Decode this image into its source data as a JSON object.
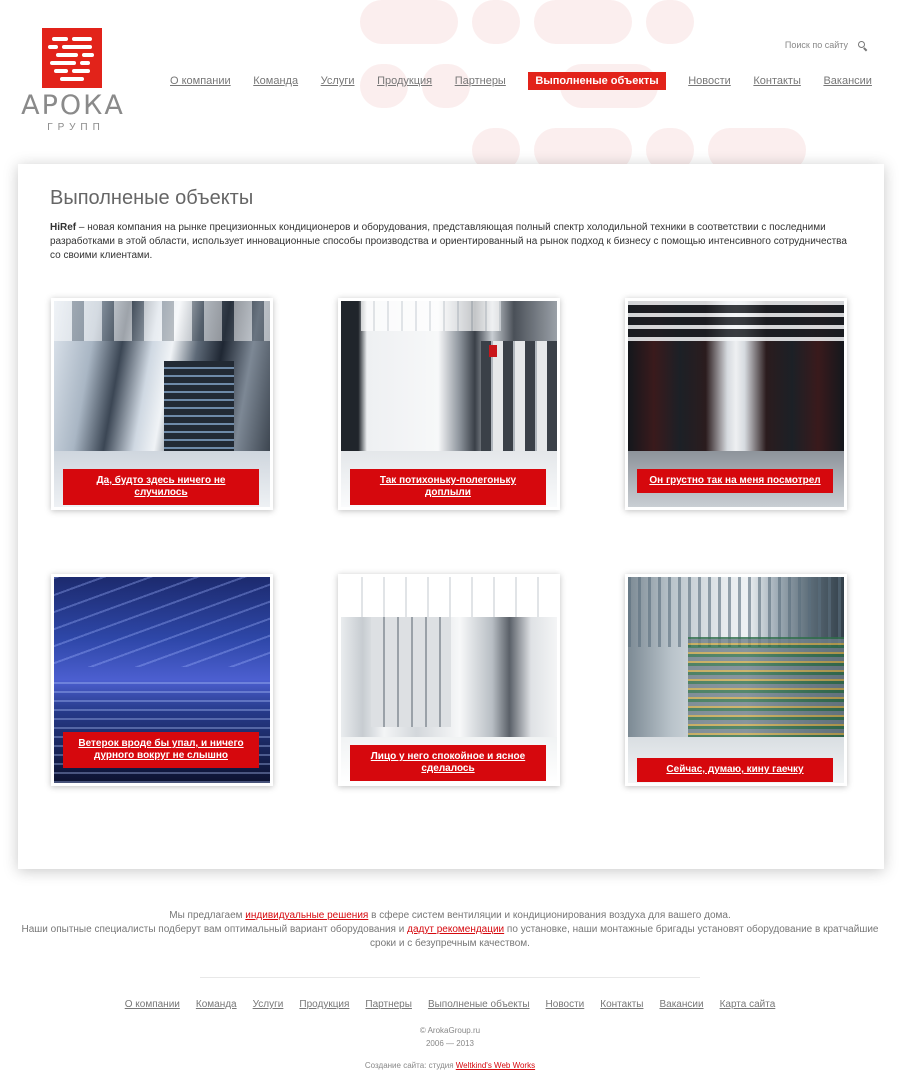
{
  "brand": {
    "name": "АРОКА",
    "sub": "ГРУПП",
    "accent": "#e2231a"
  },
  "search": {
    "label": "Поиск по сайту",
    "icon": "search-icon"
  },
  "nav": [
    {
      "label": "О компании",
      "active": false
    },
    {
      "label": "Команда",
      "active": false
    },
    {
      "label": "Услуги",
      "active": false
    },
    {
      "label": "Продукция",
      "active": false
    },
    {
      "label": "Партнеры",
      "active": false
    },
    {
      "label": "Выполненые объекты",
      "active": true
    },
    {
      "label": "Новости",
      "active": false
    },
    {
      "label": "Контакты",
      "active": false
    },
    {
      "label": "Вакансии",
      "active": false
    }
  ],
  "main": {
    "title": "Выполненые объекты",
    "intro_strong": "HiRef",
    "intro_rest": " – новая компания на рынке прецизионных кондиционеров и оборудования, представляющая полный спектр холодильной техники в соответствии с последними разработками в этой области, использует инновационные способы производства и ориентированный на рынок подход к бизнесу с помощью интенсивного сотрудничества со своими клиентами.",
    "tiles": [
      {
        "caption": "Да, будто здесь ничего не случилось"
      },
      {
        "caption": "Так потихоньку-полегоньку доплыли"
      },
      {
        "caption": "Он грустно так на меня посмотрел"
      },
      {
        "caption": "Ветерок вроде бы упал, и ничего дурного вокруг не слышно"
      },
      {
        "caption": "Лицо у него спокойное и ясное сделалось"
      },
      {
        "caption": "Сейчас, думаю, кину гаечку"
      }
    ]
  },
  "footer": {
    "p1_before": "Мы предлагаем ",
    "p1_link": "индивидуальные решения",
    "p1_after": " в сфере систем вентиляции и кондиционирования воздуха для вашего дома.",
    "p2_before": "Наши опытные специалисты подберут вам оптимальный вариант оборудования и ",
    "p2_link": "дадут рекомендации",
    "p2_after": " по установке, наши монтажные бригады установят оборудование в кратчайшие сроки и с безупречным качеством.",
    "nav": [
      "О компании",
      "Команда",
      "Услуги",
      "Продукция",
      "Партнеры",
      "Выполненые объекты",
      "Новости",
      "Контакты",
      "Вакансии",
      "Карта сайта"
    ],
    "copyright": "© ArokaGroup.ru",
    "years": "2006 — 2013",
    "credit_prefix": "Создание сайта: студия ",
    "credit_link": "Weltkind's Web Works"
  }
}
